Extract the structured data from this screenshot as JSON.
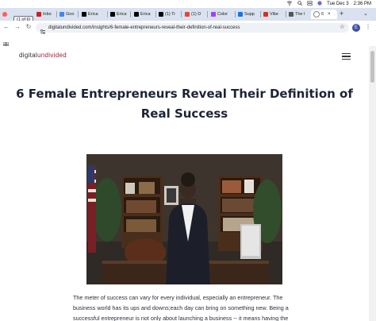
{
  "menubar": {
    "date": "Tue Dec 3",
    "time": "2:36 PM"
  },
  "tab_counter": "(1 of 6)",
  "tabs": [
    {
      "label": "Inbo",
      "color": "#c5221f"
    },
    {
      "label": "Goo",
      "color": "#4285f4"
    },
    {
      "label": "Erica",
      "color": "#000000"
    },
    {
      "label": "Erica",
      "color": "#000000"
    },
    {
      "label": "Erica",
      "color": "#000000"
    },
    {
      "label": "(1) Tr",
      "color": "#000000"
    },
    {
      "label": "(1) D",
      "color": "#e8453c"
    },
    {
      "label": "Color",
      "color": "#a142f4"
    },
    {
      "label": "Supp",
      "color": "#1a73e8"
    },
    {
      "label": "Vibe",
      "color": "#d93025"
    },
    {
      "label": "The I",
      "color": "#555555"
    },
    {
      "label": "6",
      "color": "#ffffff"
    }
  ],
  "new_tab_symbol": "+",
  "toolbar": {
    "back": "←",
    "forward": "→",
    "reload": "↻",
    "url": "digitalundivided.com/insights/6-female-entrepreneurs-reveal-their-definition-of-real-success",
    "profile_initial": "E"
  },
  "site": {
    "logo_part1": "digital",
    "logo_part2": "undivided",
    "accent_color": "#9b1c3a"
  },
  "article": {
    "title": "6 Female Entrepreneurs Reveal Their Definition of Real Success",
    "body": "The meter of success can vary for every individual, especially an entrepreneur. The business world has its ups and downs;each day can bring on something new. Being a successful entrepreneur is not only about launching a business -- it means having the"
  }
}
